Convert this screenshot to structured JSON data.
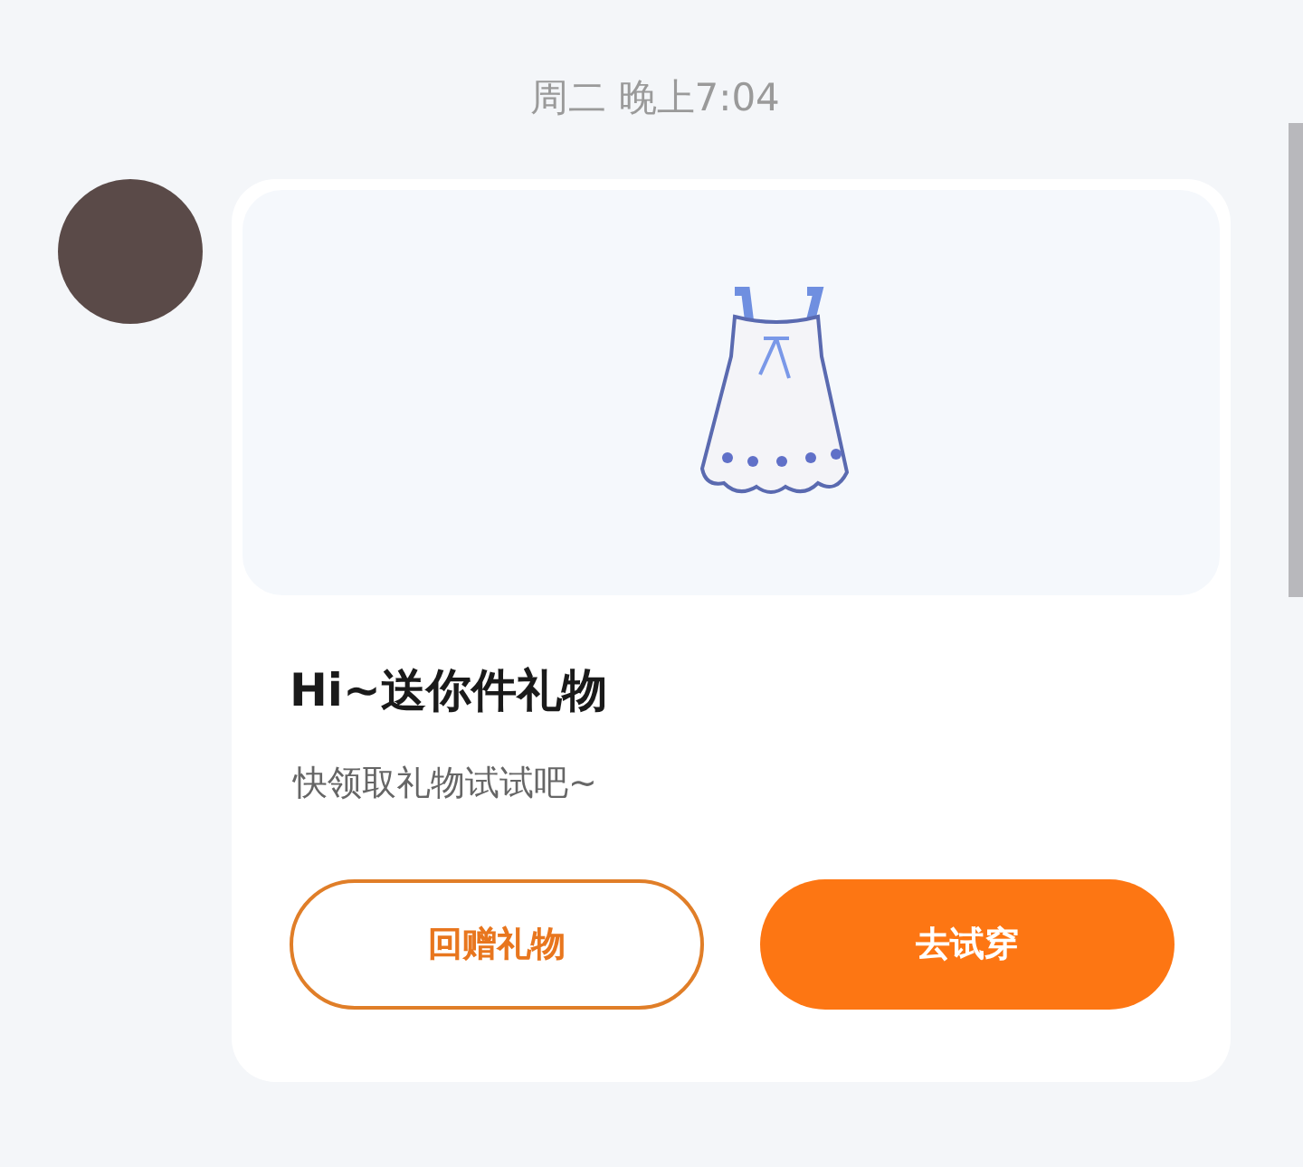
{
  "timestamp": "周二 晚上7:04",
  "message": {
    "title": "Hi~送你件礼物",
    "subtitle": "快领取礼物试试吧~",
    "buttons": [
      {
        "label": "回赠礼物",
        "kind": "outline"
      },
      {
        "label": "去试穿",
        "kind": "filled"
      }
    ]
  }
}
